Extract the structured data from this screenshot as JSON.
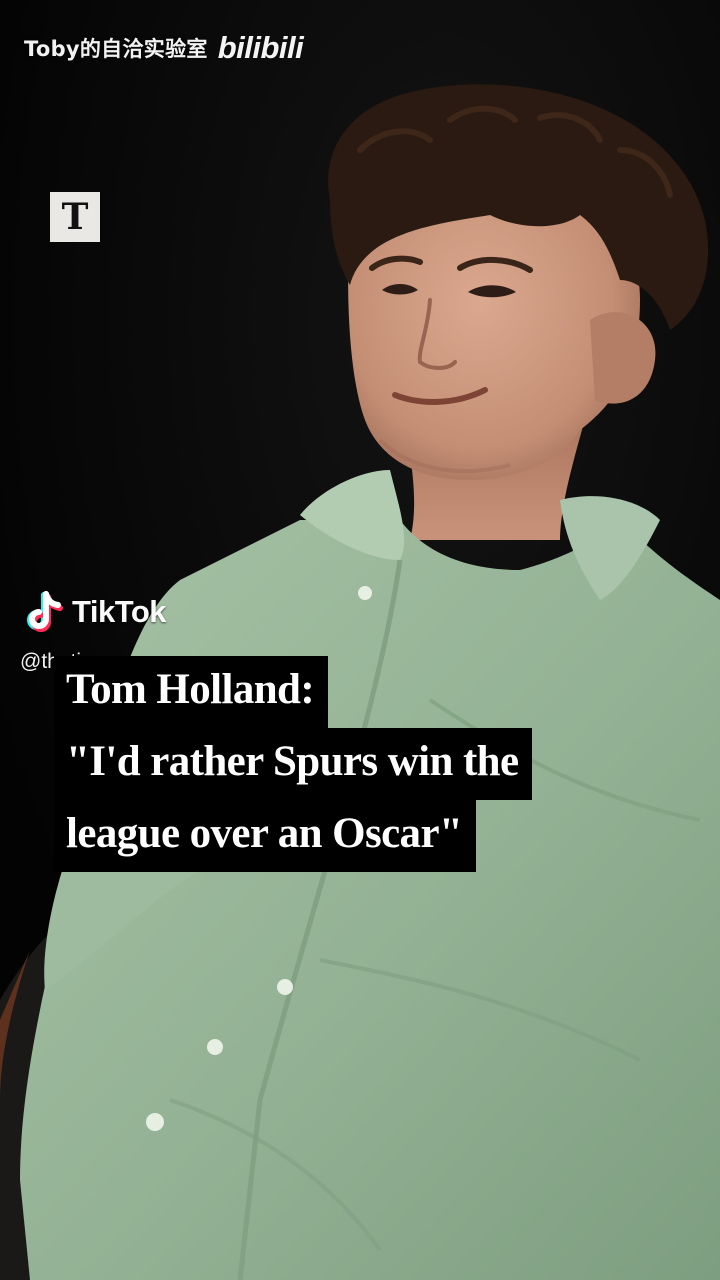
{
  "video": {
    "description_colors": {
      "background": "#050505",
      "shirt": "#94b296",
      "skin": "#c8957c",
      "hair": "#2b1a12",
      "chair": "#1c1a18"
    }
  },
  "watermark": {
    "channel_name": "Toby的自洽实验室",
    "site_logo_text": "bilibili"
  },
  "publisher_logo": {
    "letter": "T",
    "icon": "the-times-logo-icon"
  },
  "tiktok": {
    "wordmark": "TikTok",
    "handle": "@thetimes",
    "icon": "tiktok-note-icon"
  },
  "caption": {
    "lines": [
      "Tom Holland:",
      "\"I'd rather Spurs win the",
      "league over an Oscar\""
    ]
  }
}
